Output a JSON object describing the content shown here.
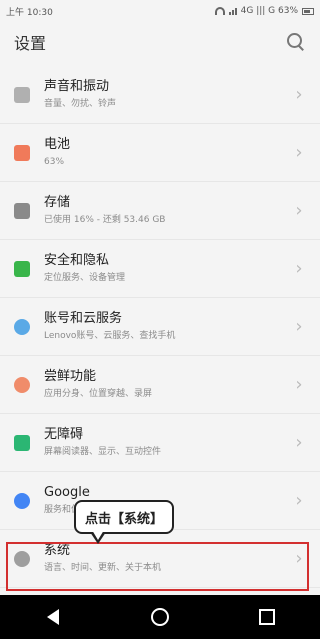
{
  "status": {
    "left": "上午 10:30",
    "right": "4G ||| G 63%"
  },
  "header": {
    "title": "设置",
    "search_icon": "search-icon"
  },
  "items": [
    {
      "id": "sound",
      "label": "声音和振动",
      "subtitle": "音量、勿扰、铃声",
      "icon_name": "speaker-icon",
      "icon_color": "#b0b0b0"
    },
    {
      "id": "battery",
      "label": "电池",
      "subtitle": "63%",
      "icon_name": "battery-icon",
      "icon_color": "#f07a5a"
    },
    {
      "id": "storage",
      "label": "存储",
      "subtitle": "已使用 16% - 还剩 53.46 GB",
      "icon_name": "storage-icon",
      "icon_color": "#8a8a8a"
    },
    {
      "id": "security",
      "label": "安全和隐私",
      "subtitle": "定位服务、设备管理",
      "icon_name": "lock-icon",
      "icon_color": "#39b54a"
    },
    {
      "id": "accounts",
      "label": "账号和云服务",
      "subtitle": "Lenovo账号、云服务、查找手机",
      "icon_name": "cloud-icon",
      "icon_color": "#5aa9e6"
    },
    {
      "id": "features",
      "label": "尝鲜功能",
      "subtitle": "应用分身、位置穿越、录屏",
      "icon_name": "features-icon",
      "icon_color": "#f08c6a"
    },
    {
      "id": "accessibility",
      "label": "无障碍",
      "subtitle": "屏幕阅读器、显示、互动控件",
      "icon_name": "accessibility-icon",
      "icon_color": "#2bb673"
    },
    {
      "id": "google",
      "label": "Google",
      "subtitle": "服务和偏好设置",
      "icon_name": "google-icon",
      "icon_color": "#4285F4"
    },
    {
      "id": "system",
      "label": "系统",
      "subtitle": "语言、时间、更新、关于本机",
      "icon_name": "info-icon",
      "icon_color": "#9e9e9e"
    }
  ],
  "tooltip": {
    "text": "点击【系统】"
  },
  "nav": {
    "back_icon": "back-icon",
    "home_icon": "home-icon",
    "recent_icon": "recent-apps-icon"
  }
}
